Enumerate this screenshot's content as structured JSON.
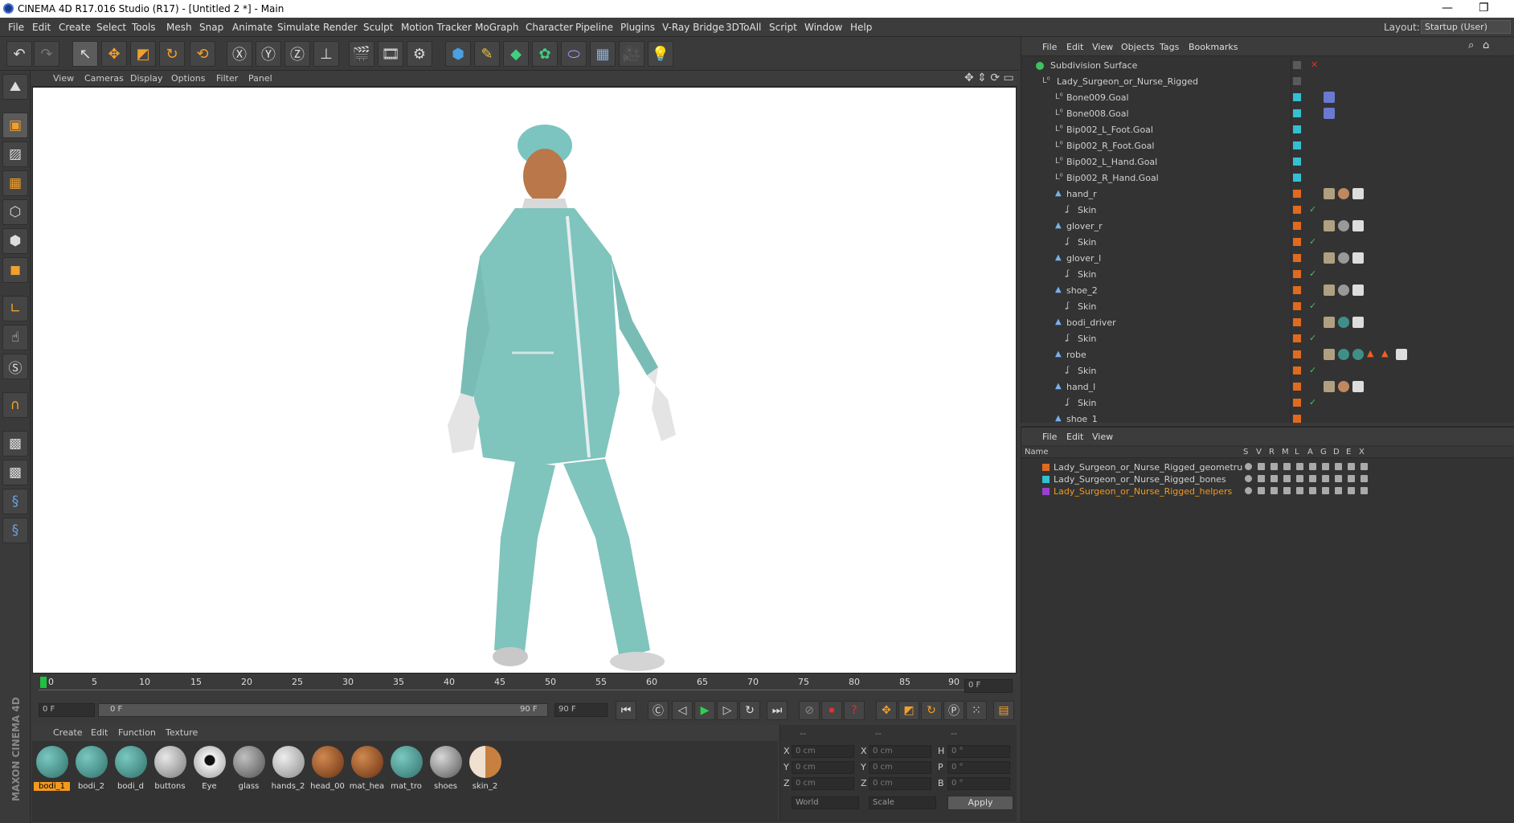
{
  "window": {
    "title": "CINEMA 4D R17.016 Studio (R17) - [Untitled 2 *] - Main",
    "minimize": "—",
    "restore": "❐"
  },
  "menu": [
    "File",
    "Edit",
    "Create",
    "Select",
    "Tools",
    "Mesh",
    "Snap",
    "Animate",
    "Simulate",
    "Render",
    "Sculpt",
    "Motion Tracker",
    "MoGraph",
    "Character",
    "Pipeline",
    "Plugins",
    "V-Ray Bridge",
    "3DToAll",
    "Script",
    "Window",
    "Help"
  ],
  "layout": {
    "label": "Layout:",
    "value": "Startup (User)"
  },
  "viewport": {
    "menu": [
      "View",
      "Cameras",
      "Display",
      "Options",
      "Filter",
      "Panel"
    ]
  },
  "timeline": {
    "ticks": [
      "0",
      "5",
      "10",
      "15",
      "20",
      "25",
      "30",
      "35",
      "40",
      "45",
      "50",
      "55",
      "60",
      "65",
      "70",
      "75",
      "80",
      "85",
      "90"
    ],
    "current_frame": "0 F",
    "start_field": "0 F",
    "slider_start": "0 F",
    "slider_end": "90 F",
    "end_field": "90 F"
  },
  "materials": {
    "menu": [
      "Create",
      "Edit",
      "Function",
      "Texture"
    ],
    "items": [
      {
        "name": "bodi_1",
        "color": "#3f8f88",
        "selected": true
      },
      {
        "name": "bodi_2",
        "color": "#3f8f88"
      },
      {
        "name": "bodi_d",
        "color": "#3f8f88"
      },
      {
        "name": "buttons",
        "color": "#b8b8b8"
      },
      {
        "name": "Eye",
        "color": "#e8e8e8"
      },
      {
        "name": "glass",
        "color": "#8a8a8a"
      },
      {
        "name": "hands_2",
        "color": "#bdbdbd"
      },
      {
        "name": "head_00",
        "color": "#b06030"
      },
      {
        "name": "mat_hea",
        "color": "#b06030"
      },
      {
        "name": "mat_tro",
        "color": "#3f8f88"
      },
      {
        "name": "shoes",
        "color": "#9a9a9a"
      },
      {
        "name": "skin_2",
        "color": "#d8a070"
      }
    ]
  },
  "coords": {
    "header": [
      "--",
      "--",
      "--"
    ],
    "rows": [
      {
        "a": "X",
        "av": "0 cm",
        "b": "X",
        "bv": "0 cm",
        "c": "H",
        "cv": "0 °"
      },
      {
        "a": "Y",
        "av": "0 cm",
        "b": "Y",
        "bv": "0 cm",
        "c": "P",
        "cv": "0 °"
      },
      {
        "a": "Z",
        "av": "0 cm",
        "b": "Z",
        "bv": "0 cm",
        "c": "B",
        "cv": "0 °"
      }
    ],
    "mode1": "World",
    "mode2": "Scale",
    "apply": "Apply"
  },
  "objects": {
    "menu": [
      "File",
      "Edit",
      "View",
      "Objects",
      "Tags",
      "Bookmarks"
    ],
    "rows": [
      {
        "name": "Subdivision Surface",
        "indent": 0,
        "sw": "#5a5a5a",
        "icon": "subdiv"
      },
      {
        "name": "Lady_Surgeon_or_Nurse_Rigged",
        "indent": 1,
        "sw": "#5a5a5a",
        "icon": "null"
      },
      {
        "name": "Bone009.Goal",
        "indent": 2,
        "sw": "#33c0d0",
        "icon": "null"
      },
      {
        "name": "Bone008.Goal",
        "indent": 2,
        "sw": "#33c0d0",
        "icon": "null"
      },
      {
        "name": "Bip002_L_Foot.Goal",
        "indent": 2,
        "sw": "#33c0d0",
        "icon": "null"
      },
      {
        "name": "Bip002_R_Foot.Goal",
        "indent": 2,
        "sw": "#33c0d0",
        "icon": "null"
      },
      {
        "name": "Bip002_L_Hand.Goal",
        "indent": 2,
        "sw": "#33c0d0",
        "icon": "null"
      },
      {
        "name": "Bip002_R_Hand.Goal",
        "indent": 2,
        "sw": "#33c0d0",
        "icon": "null"
      },
      {
        "name": "hand_r",
        "indent": 2,
        "sw": "#e06a20",
        "icon": "poly"
      },
      {
        "name": "Skin",
        "indent": 3,
        "sw": "#e06a20",
        "icon": "skin"
      },
      {
        "name": "glover_r",
        "indent": 2,
        "sw": "#e06a20",
        "icon": "poly"
      },
      {
        "name": "Skin",
        "indent": 3,
        "sw": "#e06a20",
        "icon": "skin"
      },
      {
        "name": "glover_l",
        "indent": 2,
        "sw": "#e06a20",
        "icon": "poly"
      },
      {
        "name": "Skin",
        "indent": 3,
        "sw": "#e06a20",
        "icon": "skin"
      },
      {
        "name": "shoe_2",
        "indent": 2,
        "sw": "#e06a20",
        "icon": "poly"
      },
      {
        "name": "Skin",
        "indent": 3,
        "sw": "#e06a20",
        "icon": "skin"
      },
      {
        "name": "bodi_driver",
        "indent": 2,
        "sw": "#e06a20",
        "icon": "poly"
      },
      {
        "name": "Skin",
        "indent": 3,
        "sw": "#e06a20",
        "icon": "skin"
      },
      {
        "name": "robe",
        "indent": 2,
        "sw": "#e06a20",
        "icon": "poly"
      },
      {
        "name": "Skin",
        "indent": 3,
        "sw": "#e06a20",
        "icon": "skin"
      },
      {
        "name": "hand_l",
        "indent": 2,
        "sw": "#e06a20",
        "icon": "poly"
      },
      {
        "name": "Skin",
        "indent": 3,
        "sw": "#e06a20",
        "icon": "skin"
      },
      {
        "name": "shoe_1",
        "indent": 2,
        "sw": "#e06a20",
        "icon": "poly"
      }
    ]
  },
  "layers": {
    "menu": [
      "File",
      "Edit",
      "View"
    ],
    "columns": [
      "Name",
      "S",
      "V",
      "R",
      "M",
      "L",
      "A",
      "G",
      "D",
      "E",
      "X"
    ],
    "rows": [
      {
        "name": "Lady_Surgeon_or_Nurse_Rigged_geometru",
        "color": "#e06a20",
        "highlight": false
      },
      {
        "name": "Lady_Surgeon_or_Nurse_Rigged_bones",
        "color": "#33c0d0",
        "highlight": false
      },
      {
        "name": "Lady_Surgeon_or_Nurse_Rigged_helpers",
        "color": "#9a40d0",
        "highlight": true
      }
    ]
  },
  "brand": "MAXON CINEMA 4D"
}
